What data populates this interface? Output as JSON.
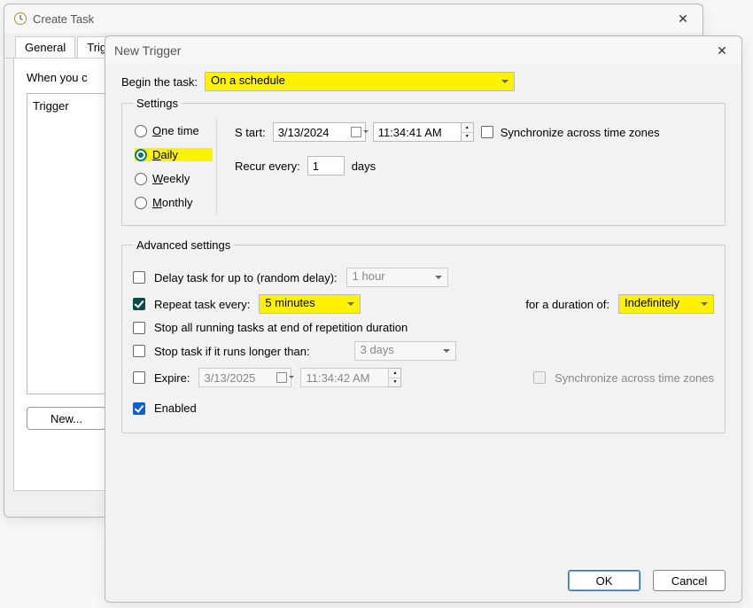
{
  "back": {
    "title": "Create Task",
    "tabs": {
      "general": "General",
      "triggers": "Trig"
    },
    "when_text": "When you c",
    "list_header": "Trigger",
    "new_btn": "New..."
  },
  "front": {
    "title": "New Trigger",
    "begin_label": "Begin the task:",
    "begin_value": "On a schedule",
    "settings_legend": "Settings",
    "radio": {
      "one_time": "ne time",
      "daily": "aily",
      "weekly": "eekly",
      "monthly": "onthly"
    },
    "start_label": " tart:",
    "start_date": "3/13/2024",
    "start_time": "11:34:41 AM",
    "sync_label": "Synchronize across time zones",
    "recur_label": "Re",
    "recur_label2": "ur every:",
    "recur_value": "1",
    "recur_unit": "days",
    "adv_legend": "Advanced settings",
    "delay_label": "Delay task for up to (random delay):",
    "delay_value": "1 hour",
    "repeat_label1": "Re",
    "repeat_label2": "eat task every:",
    "repeat_value": "5 minutes",
    "for_dur_label": "for a duration of:",
    "for_dur_value": "Indefinitely",
    "stop_all_label": "Stop all running tasks at end of repetition duration",
    "stop_longer_label": "Stop task if it runs ",
    "stop_longer_label2": "onger than:",
    "stop_longer_value": "3 days",
    "expire_label": "Ex",
    "expire_label2": "ire:",
    "expire_date": "3/13/2025",
    "expire_time": "11:34:42 AM",
    "expire_sync": "Synchronize across time zones",
    "enabled_label": "Ena",
    "enabled_label2": "led",
    "ok": "OK",
    "cancel": "Cancel"
  }
}
